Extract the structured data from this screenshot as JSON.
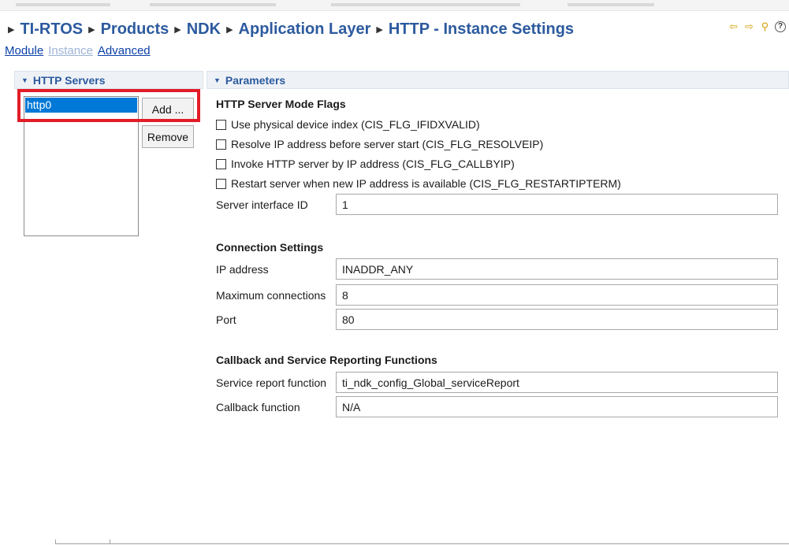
{
  "breadcrumb": [
    "TI-RTOS",
    "Products",
    "NDK",
    "Application Layer",
    "HTTP - Instance Settings"
  ],
  "header_icons": [
    "back-arrow-icon",
    "forward-arrow-icon",
    "link-icon",
    "help-icon"
  ],
  "tabs": {
    "module": "Module",
    "instance": "Instance",
    "advanced": "Advanced"
  },
  "servers_panel": {
    "title": "HTTP Servers",
    "items": [
      "http0"
    ],
    "add_label": "Add ...",
    "remove_label": "Remove"
  },
  "params_panel": {
    "title": "Parameters",
    "mode_flags": {
      "title": "HTTP Server Mode Flags",
      "flags": [
        {
          "label": "Use physical device index (CIS_FLG_IFIDXVALID)",
          "checked": false
        },
        {
          "label": "Resolve IP address before server start (CIS_FLG_RESOLVEIP)",
          "checked": false
        },
        {
          "label": "Invoke HTTP server by IP address (CIS_FLG_CALLBYIP)",
          "checked": false
        },
        {
          "label": "Restart server when new IP address is available (CIS_FLG_RESTARTIPTERM)",
          "checked": false
        }
      ],
      "interface_label": "Server interface ID",
      "interface_value": "1"
    },
    "connection": {
      "title": "Connection Settings",
      "ip_label": "IP address",
      "ip_value": "INADDR_ANY",
      "max_conn_label": "Maximum connections",
      "max_conn_value": "8",
      "port_label": "Port",
      "port_value": "80"
    },
    "callbacks": {
      "title": "Callback and Service Reporting Functions",
      "service_label": "Service report function",
      "service_value": "ti_ndk_config_Global_serviceReport",
      "callback_label": "Callback function",
      "callback_value": "N/A"
    }
  },
  "colors": {
    "accent": "#2c5a9e",
    "selection": "#0078d7",
    "highlight_box": "#e21d28"
  }
}
